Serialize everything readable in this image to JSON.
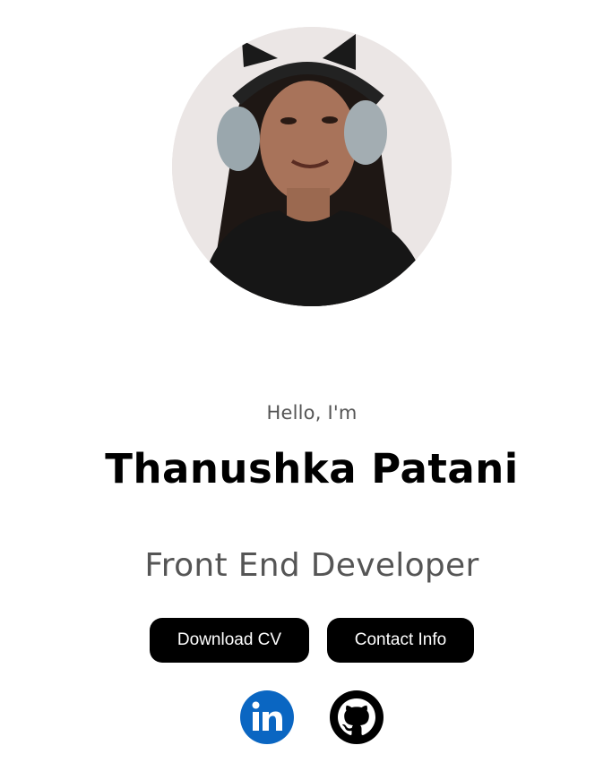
{
  "hero": {
    "greeting": "Hello, I'm",
    "name": "Thanushka Patani",
    "role": "Front End Developer"
  },
  "buttons": {
    "download_cv": "Download CV",
    "contact_info": "Contact Info"
  },
  "social": [
    {
      "icon": "linkedin-icon",
      "color": "#0a66c2"
    },
    {
      "icon": "github-icon",
      "color": "#000000"
    }
  ]
}
